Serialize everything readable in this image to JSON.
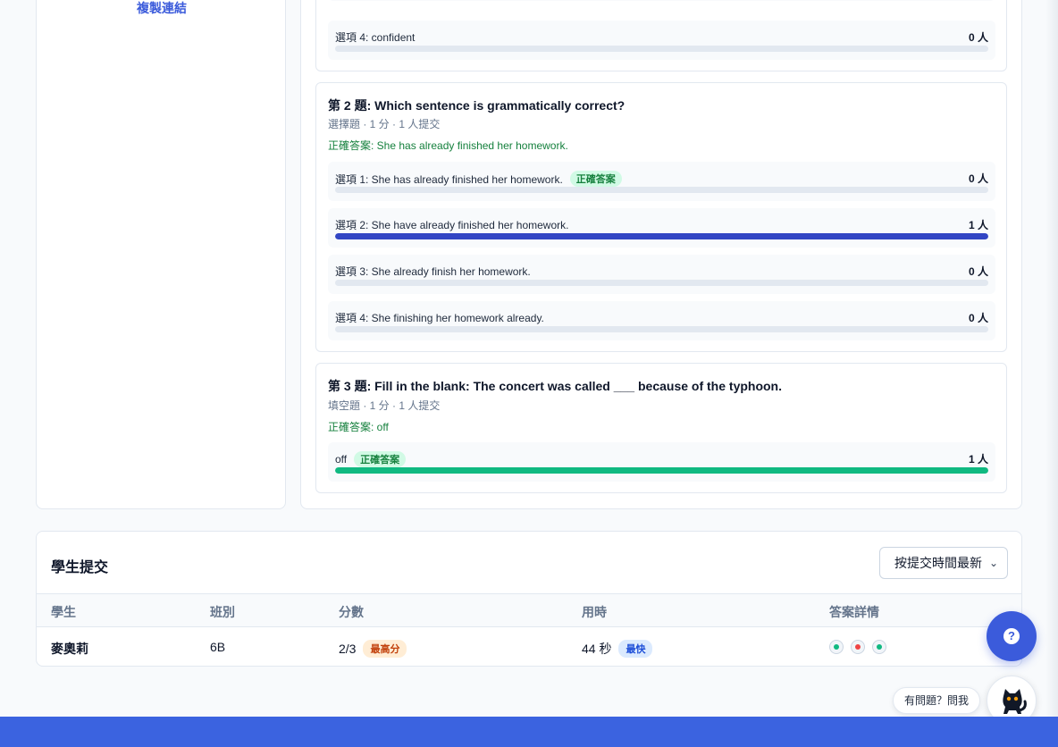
{
  "sidebar": {
    "copy_link": "複製連結"
  },
  "questions": [
    {
      "options": [
        {
          "label": "選項 4: confident",
          "count": "0 人",
          "fraction": 0
        }
      ]
    },
    {
      "title": "第 2 題: Which sentence is grammatically correct?",
      "meta": "選擇題 · 1 分 · 1 人提交",
      "correct_answer": "正確答案: She has already finished her homework.",
      "options": [
        {
          "label": "選項 1: She has already finished her homework.",
          "badge": "正確答案",
          "count": "0 人",
          "fraction": 0
        },
        {
          "label": "選項 2: She have already finished her homework.",
          "count": "1 人",
          "fraction": 1
        },
        {
          "label": "選項 3: She already finish her homework.",
          "count": "0 人",
          "fraction": 0
        },
        {
          "label": "選項 4: She finishing her homework already.",
          "count": "0 人",
          "fraction": 0
        }
      ]
    },
    {
      "title": "第 3 題: Fill in the blank: The concert was called ___ because of the typhoon.",
      "meta": "填空題 · 1 分 · 1 人提交",
      "correct_answer": "正確答案: off",
      "options": [
        {
          "label": "off",
          "badge": "正確答案",
          "count": "1 人",
          "fraction": 1
        }
      ]
    }
  ],
  "submissions": {
    "title": "學生提交",
    "sort_selected": "按提交時間最新",
    "columns": [
      "學生",
      "班別",
      "分數",
      "用時",
      "答案詳情"
    ],
    "rows": [
      {
        "student": "麥奧莉",
        "class": "6B",
        "score": "2/3",
        "score_badge": "最高分",
        "time": "44 秒",
        "time_badge": "最快",
        "answers": [
          "correct",
          "wrong",
          "correct"
        ]
      }
    ]
  },
  "help": {
    "ask_label": "有問題？問我"
  },
  "colors": {
    "accent": "#3b5bdb",
    "bar_selected": "#3245c4",
    "bar_correct": "#10b981",
    "footer": "#3b63e0"
  },
  "icons": {
    "help": "question-circle-icon",
    "assistant": "black-cat-icon",
    "sort": "chevron-down-icon"
  }
}
